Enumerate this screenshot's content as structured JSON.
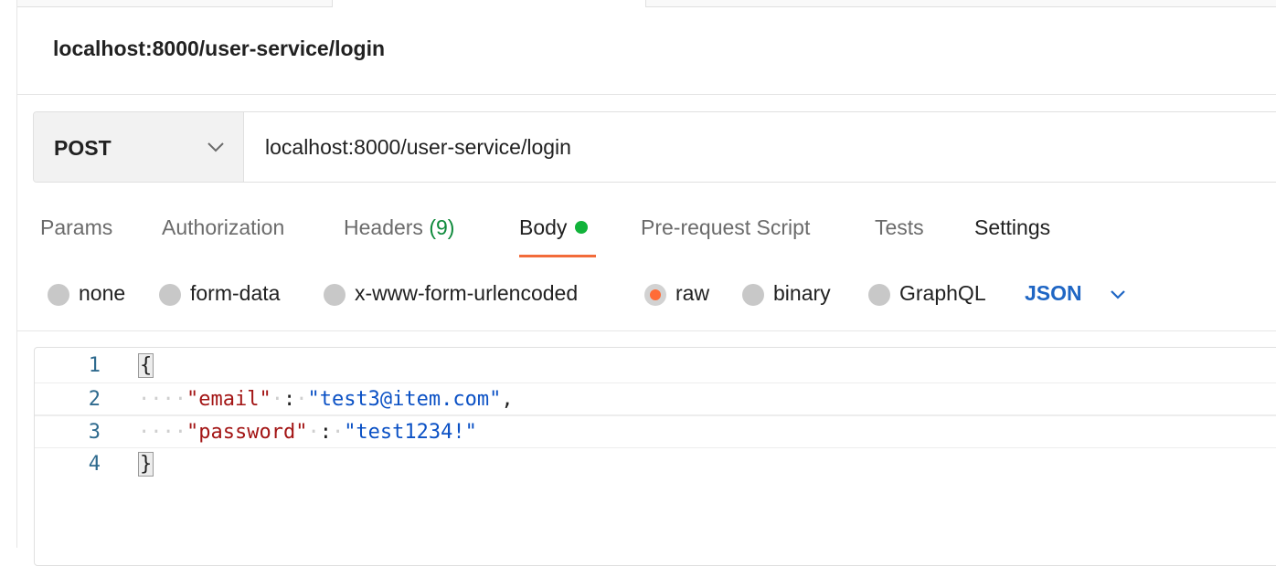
{
  "request_title": "localhost:8000/user-service/login",
  "method": "POST",
  "url": "localhost:8000/user-service/login",
  "tabs": {
    "params": "Params",
    "authorization": "Authorization",
    "headers": "Headers",
    "headers_count": "(9)",
    "body": "Body",
    "pre_request": "Pre-request Script",
    "tests": "Tests",
    "settings": "Settings"
  },
  "body_types": {
    "none": "none",
    "form_data": "form-data",
    "urlencoded": "x-www-form-urlencoded",
    "raw": "raw",
    "binary": "binary",
    "graphql": "GraphQL",
    "selected": "raw"
  },
  "language": "JSON",
  "editor": {
    "line_numbers": [
      "1",
      "2",
      "3",
      "4"
    ],
    "open_brace": "{",
    "close_brace": "}",
    "indent": "····",
    "email_key": "\"email\"",
    "email_value": "\"test3@item.com\"",
    "password_key": "\"password\"",
    "password_value": "\"test1234!\"",
    "colon": ":",
    "comma": ","
  },
  "colors": {
    "accent": "#ff6c37",
    "active_tab_underline": "#f26b3a",
    "body_dot": "#11b33a",
    "language_link": "#1f66c4",
    "json_key": "#a31515",
    "json_string": "#0b51c5"
  }
}
